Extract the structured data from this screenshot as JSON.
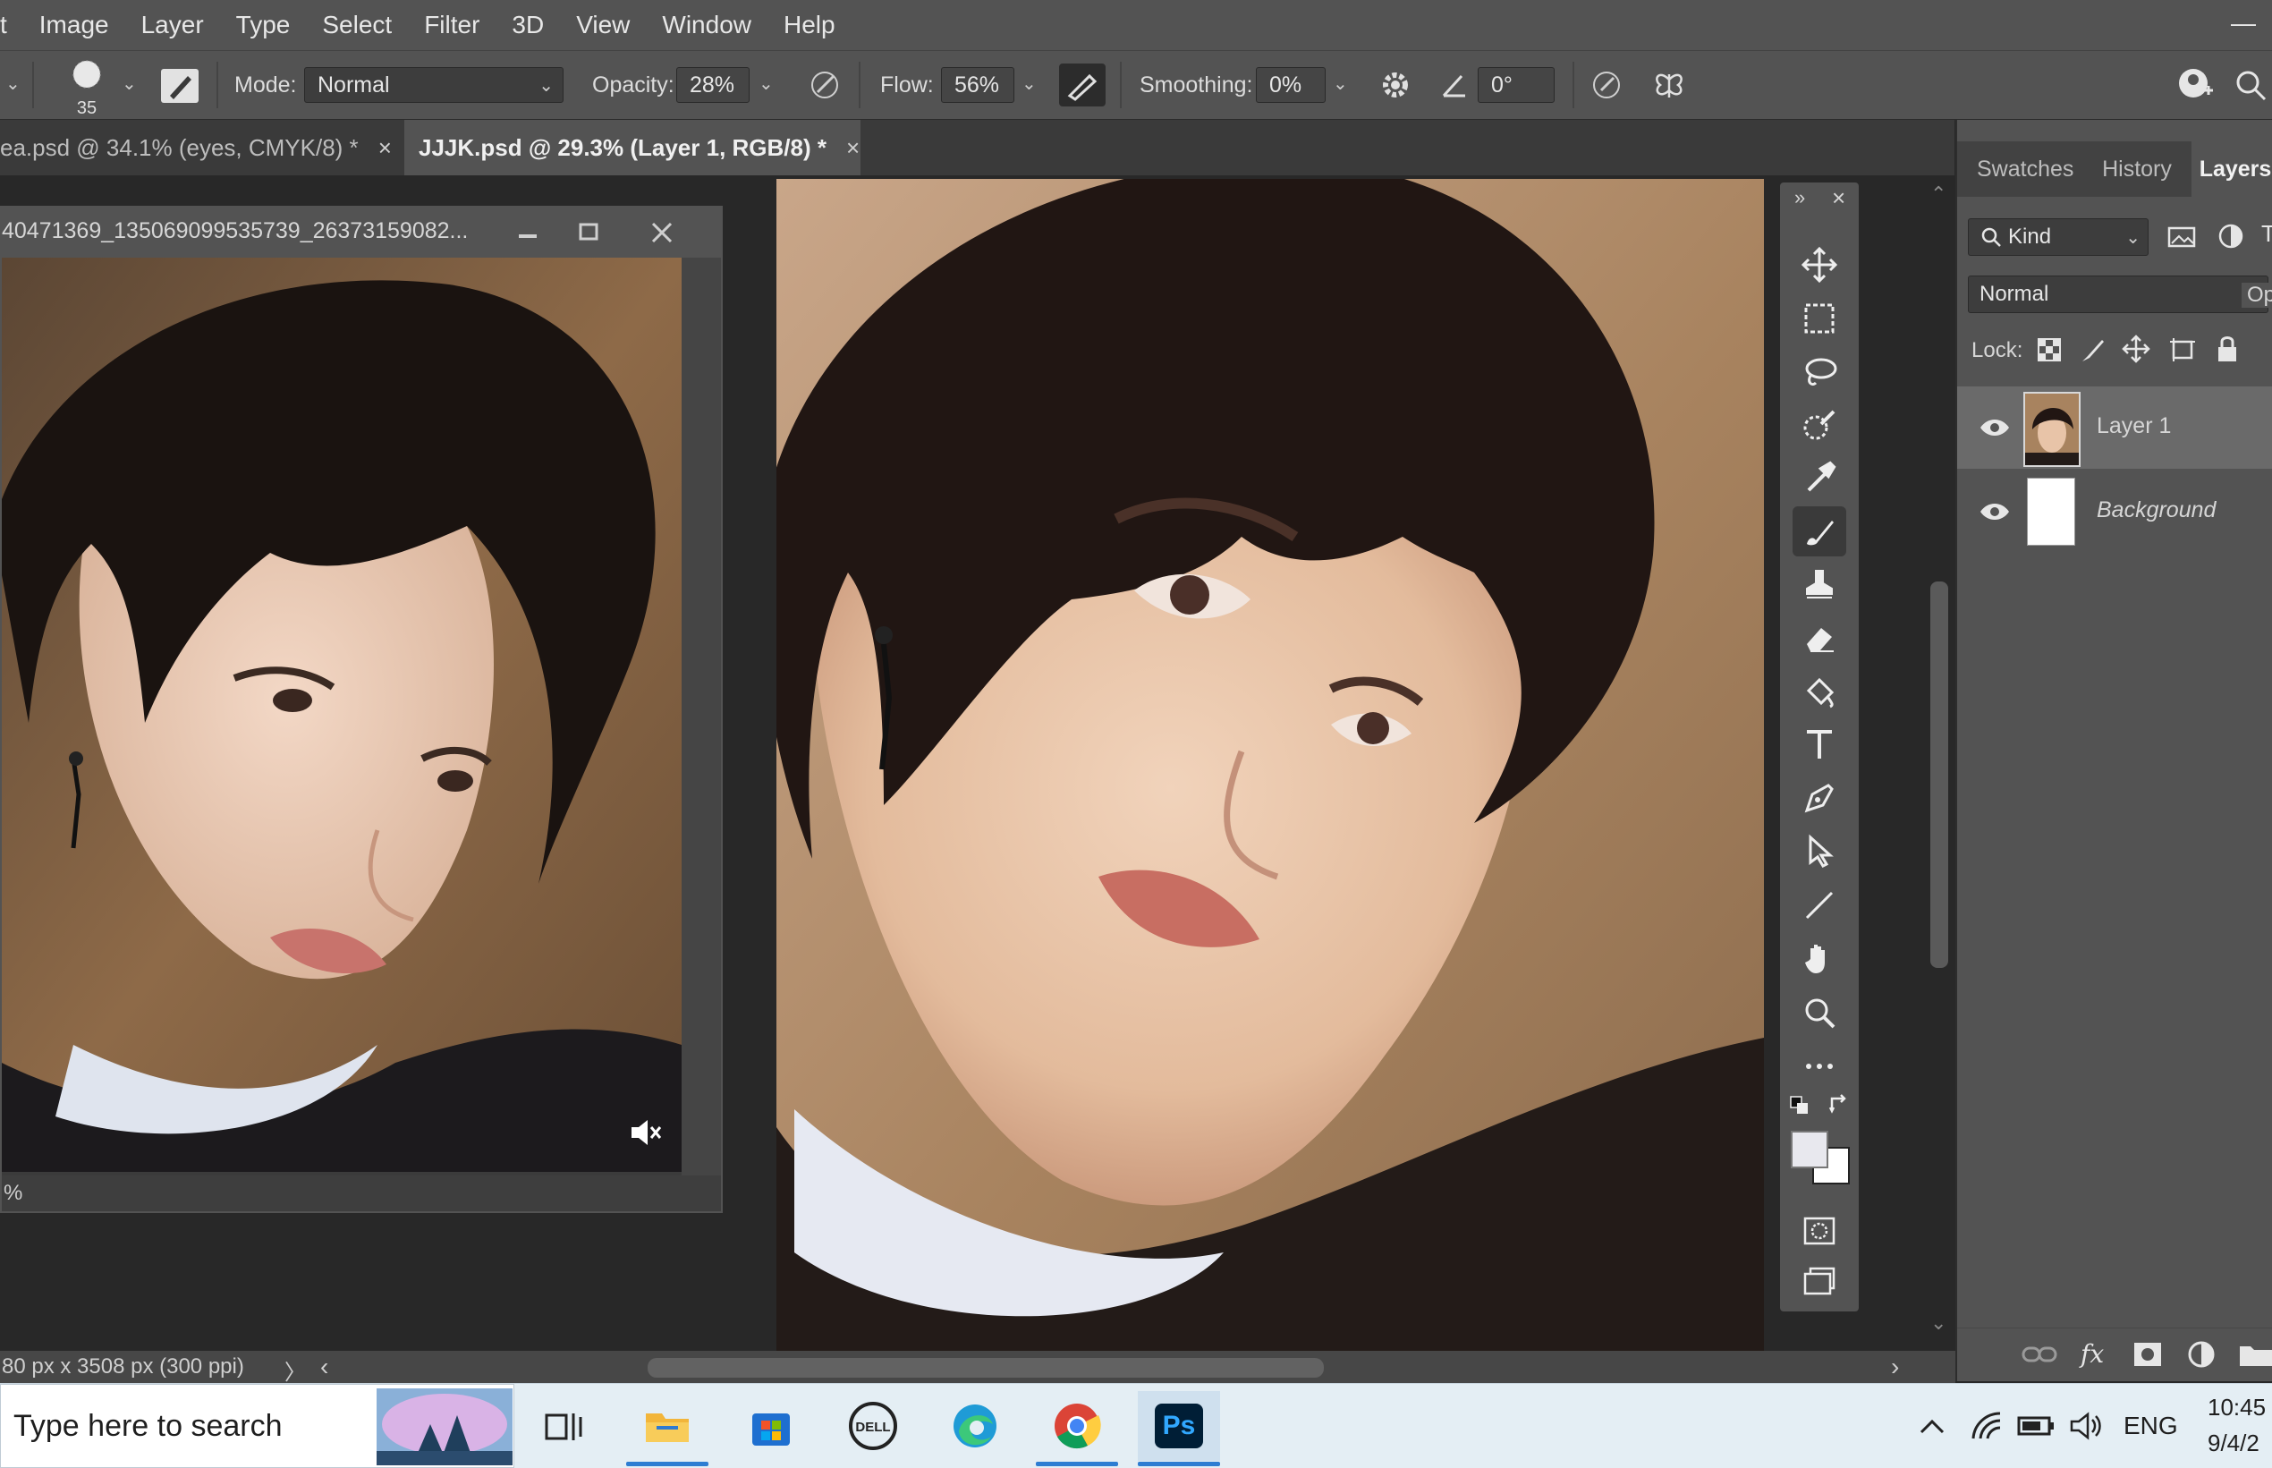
{
  "menu": {
    "items": [
      "t",
      "Image",
      "Layer",
      "Type",
      "Select",
      "Filter",
      "3D",
      "View",
      "Window",
      "Help"
    ],
    "minimize_glyph": "—"
  },
  "options": {
    "brush_size": "35",
    "mode_label": "Mode:",
    "mode_value": "Normal",
    "opacity_label": "Opacity:",
    "opacity_value": "28%",
    "flow_label": "Flow:",
    "flow_value": "56%",
    "smoothing_label": "Smoothing:",
    "smoothing_value": "0%",
    "angle_value": "0°"
  },
  "tabs": [
    {
      "label": "ea.psd @ 34.1% (eyes, CMYK/8) *",
      "close": "×"
    },
    {
      "label": "JJJK.psd @ 29.3% (Layer 1, RGB/8) *",
      "close": "×"
    }
  ],
  "floating_window": {
    "title": "40471369_135069099535739_26373159082...",
    "status": "%"
  },
  "bottom_status": {
    "doc_info": "80 px x 3508 px (300 ppi)",
    "arrow": "〉",
    "scroll_left": "‹",
    "scroll_right": "›"
  },
  "panel": {
    "tabs": [
      "Swatches",
      "History",
      "Layers"
    ],
    "active_tab": "Layers",
    "filter_label": "Kind",
    "blend_mode": "Normal",
    "opacity_abbrev": "Opa",
    "lock_label": "Lock:",
    "layers": [
      {
        "name": "Layer 1",
        "visible": true,
        "selected": true
      },
      {
        "name": "Background",
        "visible": true,
        "selected": false
      }
    ]
  },
  "taskbar": {
    "search_placeholder": "Type here to search",
    "language": "ENG",
    "time": "10:45",
    "date": "9/4/2",
    "ps_label": "Ps"
  },
  "colors": {
    "ui_dark": "#282828",
    "ui_mid": "#535353",
    "accent_blue": "#2d7dd2",
    "skin": "#e6bfa4",
    "hair": "#201613",
    "background_tan": "#b08a6a"
  }
}
